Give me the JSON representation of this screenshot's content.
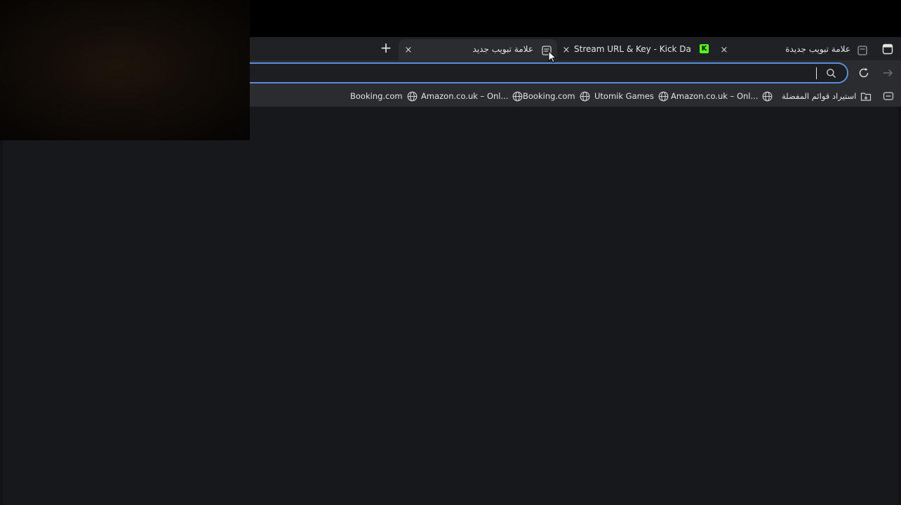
{
  "tabs": [
    {
      "title": "علامة تبويب جديدة",
      "icon": "tab-page-icon",
      "active": true
    },
    {
      "title": "Stream URL & Key - Kick Dashboard",
      "icon": "kick-logo-icon",
      "kick_glyph": "K",
      "active": false
    },
    {
      "title": "علامة تبويب جديدة",
      "icon": "tab-page-icon",
      "active": false
    }
  ],
  "new_tab_symbol": "+",
  "close_symbol": "×",
  "omnibox": {
    "value": "",
    "placeholder": ""
  },
  "bookmarks": [
    {
      "label": "استيراد قوائم المفضلة",
      "icon": "import-folder-icon"
    },
    {
      "label": "Amazon.co.uk – Onl...",
      "icon": "globe-icon"
    },
    {
      "label": "Utomik Games",
      "icon": "globe-icon"
    },
    {
      "label": "Booking.com",
      "icon": "globe-icon"
    },
    {
      "label": "Amazon.co.uk – Onl...",
      "icon": "globe-icon"
    },
    {
      "label": "Booking.com",
      "icon": "globe-icon"
    }
  ],
  "colors": {
    "tabstrip_bg": "#202124",
    "toolbar_bg": "#2b2c2f",
    "focus_ring": "#5a8fd8",
    "kick_green": "#53fc18",
    "content_bg": "#17181b"
  }
}
